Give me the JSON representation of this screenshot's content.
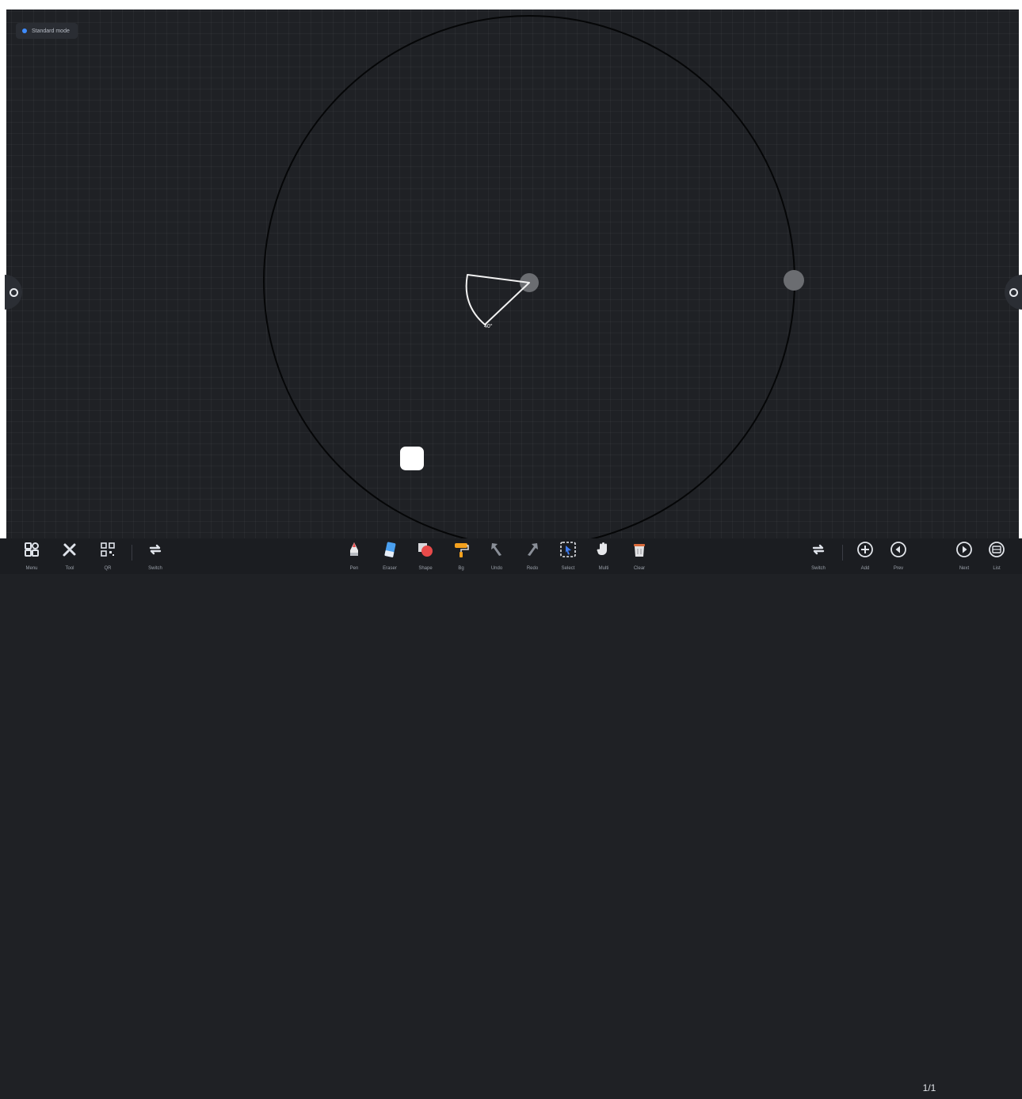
{
  "status": {
    "mode_label": "Standard mode"
  },
  "protractor": {
    "angle_label": "40°"
  },
  "toolbar": {
    "left": [
      {
        "label": "Menu",
        "icon": "menu-grid-icon"
      },
      {
        "label": "Tool",
        "icon": "tools-icon"
      },
      {
        "label": "QR",
        "icon": "qr-code-icon"
      },
      {
        "label": "Switch",
        "icon": "switch-icon"
      }
    ],
    "center": [
      {
        "label": "Pen",
        "icon": "pen-icon"
      },
      {
        "label": "Eraser",
        "icon": "eraser-icon"
      },
      {
        "label": "Shape",
        "icon": "shape-icon"
      },
      {
        "label": "Bg",
        "icon": "paint-roller-icon"
      },
      {
        "label": "Undo",
        "icon": "undo-icon"
      },
      {
        "label": "Redo",
        "icon": "redo-icon"
      },
      {
        "label": "Select",
        "icon": "select-icon"
      },
      {
        "label": "Multi",
        "icon": "multi-touch-icon"
      },
      {
        "label": "Clear",
        "icon": "trash-icon"
      }
    ],
    "right": [
      {
        "label": "Switch",
        "icon": "switch-icon"
      },
      {
        "label": "Add",
        "icon": "add-page-icon"
      },
      {
        "label": "Prev",
        "icon": "prev-page-icon"
      },
      {
        "label": "Next",
        "icon": "next-page-icon"
      },
      {
        "label": "List",
        "icon": "page-list-icon"
      }
    ],
    "page_counter": "1/1"
  }
}
